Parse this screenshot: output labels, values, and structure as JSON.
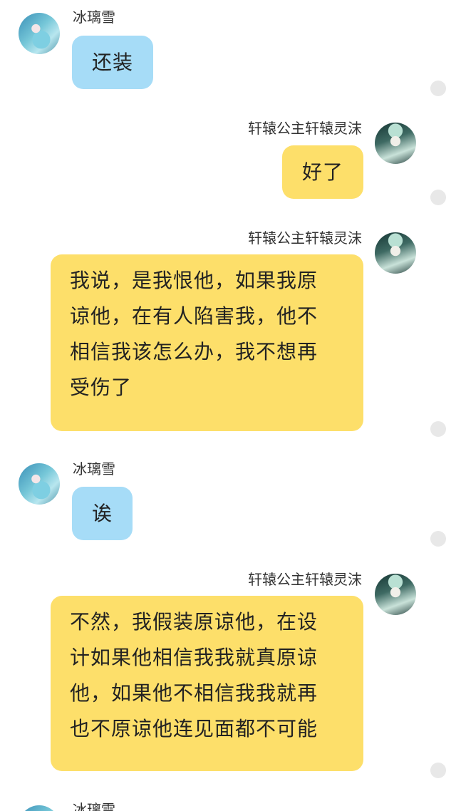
{
  "messages": [
    {
      "side": "left",
      "sender": "冰璃雪",
      "text": "还装"
    },
    {
      "side": "right",
      "sender": "轩辕公主轩辕灵沫",
      "text": "好了"
    },
    {
      "side": "right",
      "sender": "轩辕公主轩辕灵沫",
      "lines": [
        "我说，是我恨他，如果我原",
        "谅他，在有人陷害我，他不",
        "相信我该怎么办，我不想再",
        "受伤了"
      ]
    },
    {
      "side": "left",
      "sender": "冰璃雪",
      "text": "诶"
    },
    {
      "side": "right",
      "sender": "轩辕公主轩辕灵沫",
      "lines": [
        "不然，我假装原谅他，在设",
        "计如果他相信我我就真原谅",
        "他，如果他不相信我我就再",
        "也不原谅他连见面都不可能"
      ]
    },
    {
      "side": "left",
      "sender": "冰璃雪",
      "text": ""
    }
  ],
  "colors": {
    "left_bubble": "#a6dcf7",
    "right_bubble": "#fddf6a",
    "background": "#ffffff",
    "status_dot": "#e8e8e8"
  }
}
